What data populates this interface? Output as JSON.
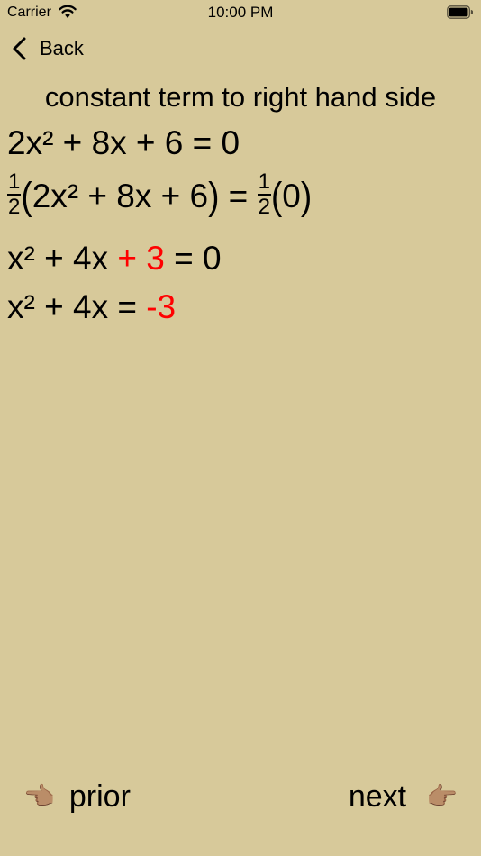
{
  "status_bar": {
    "carrier": "Carrier",
    "time": "10:00 PM"
  },
  "nav": {
    "back_label": "Back"
  },
  "step": {
    "title": "constant term to right hand side"
  },
  "equations": {
    "line1": "2x² + 8x + 6 = 0",
    "line2": {
      "frac_num": "1",
      "frac_den": "2",
      "open_paren": "(",
      "inner": "2x² + 8x + 6",
      "close_paren": ")",
      "equals": " = ",
      "rhs_frac_num": "1",
      "rhs_frac_den": "2",
      "rhs_inner": "0"
    },
    "line3": {
      "left": "x² + 4x ",
      "highlight": "+ 3",
      "right": " = 0"
    },
    "line4": {
      "left": "x² + 4x = ",
      "highlight": "-3"
    }
  },
  "bottom_nav": {
    "prior_hand": "👈🏽",
    "prior_label": "prior",
    "next_label": "next",
    "next_hand": "👉🏽"
  },
  "colors": {
    "background": "#d7c99a",
    "highlight": "#ff0000"
  }
}
